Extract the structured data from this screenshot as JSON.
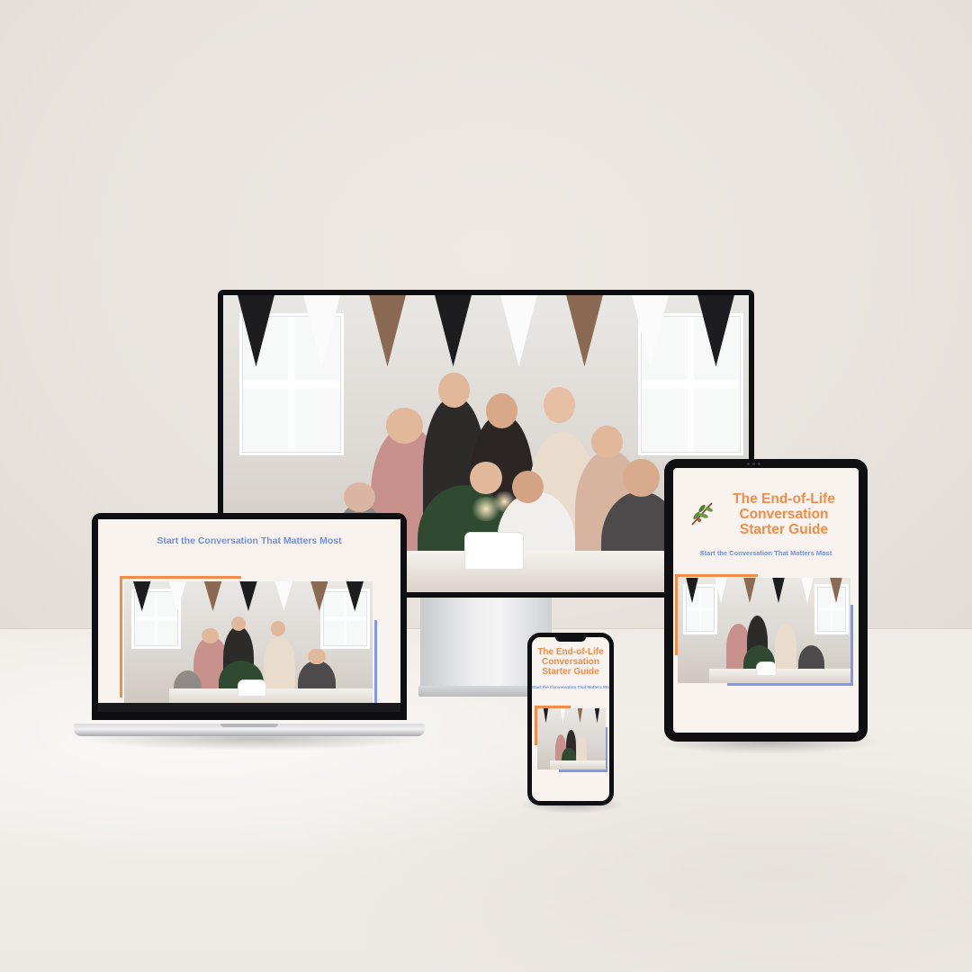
{
  "guide": {
    "title_line1": "The End-of-Life",
    "title_line2": "Conversation",
    "title_line3": "Starter Guide",
    "tagline": "Start the Conversation That Matters Most"
  },
  "devices": [
    "desktop-monitor",
    "laptop",
    "tablet",
    "phone"
  ],
  "colors": {
    "title_orange": "#f28c48",
    "tagline_blue": "#6f8fe6",
    "frame_orange": "#f28c48",
    "frame_blue": "#7d98ee",
    "page_background": "#f8f3ef"
  },
  "icons": {
    "leaf": "olive-branch-icon"
  }
}
